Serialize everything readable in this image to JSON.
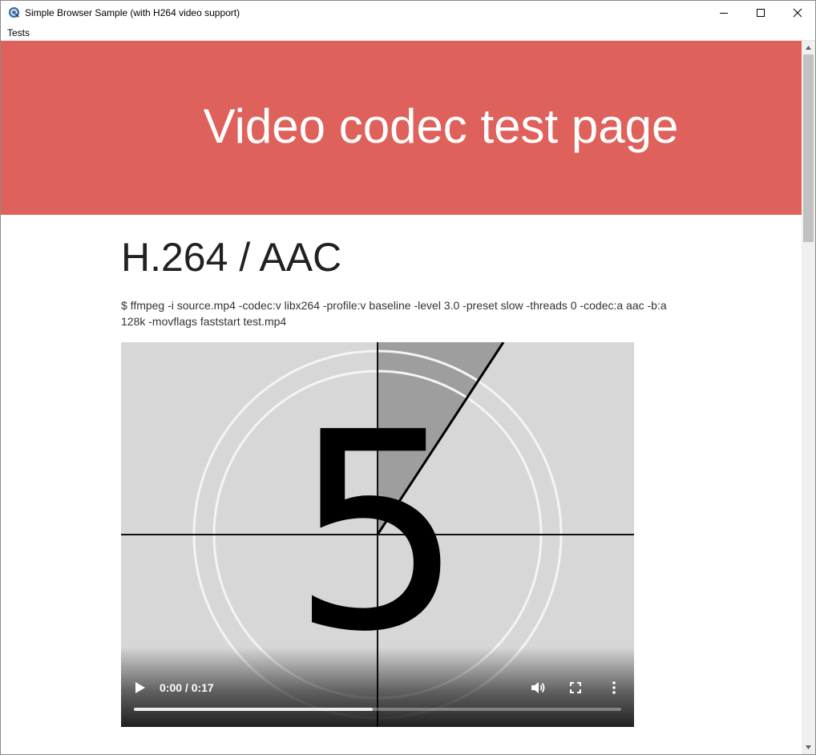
{
  "window": {
    "title": "Simple Browser Sample (with H264 video support)",
    "icons": {
      "app": "browser-globe-icon",
      "minimize": "minimize-icon",
      "maximize": "maximize-icon",
      "close": "close-icon"
    }
  },
  "menubar": {
    "items": [
      {
        "label": "Tests"
      }
    ]
  },
  "page": {
    "hero": {
      "title": "Video codec test page",
      "background": "#de615b"
    },
    "section": {
      "heading": "H.264 / AAC",
      "command": "$ ffmpeg -i source.mp4 -codec:v libx264 -profile:v baseline -level 3.0 -preset slow -threads 0 -codec:a aac -b:a 128k -movflags faststart test.mp4"
    },
    "video": {
      "frame_number": "5",
      "time": "0:00 / 0:17",
      "progress_fraction": 0.49,
      "icons": {
        "play": "play-icon",
        "volume": "volume-icon",
        "fullscreen": "fullscreen-icon",
        "more": "more-vertical-icon"
      }
    }
  },
  "colors": {
    "accent": "#de615b",
    "video_bg": "#d7d7d8",
    "wedge": "#9e9e9e"
  }
}
